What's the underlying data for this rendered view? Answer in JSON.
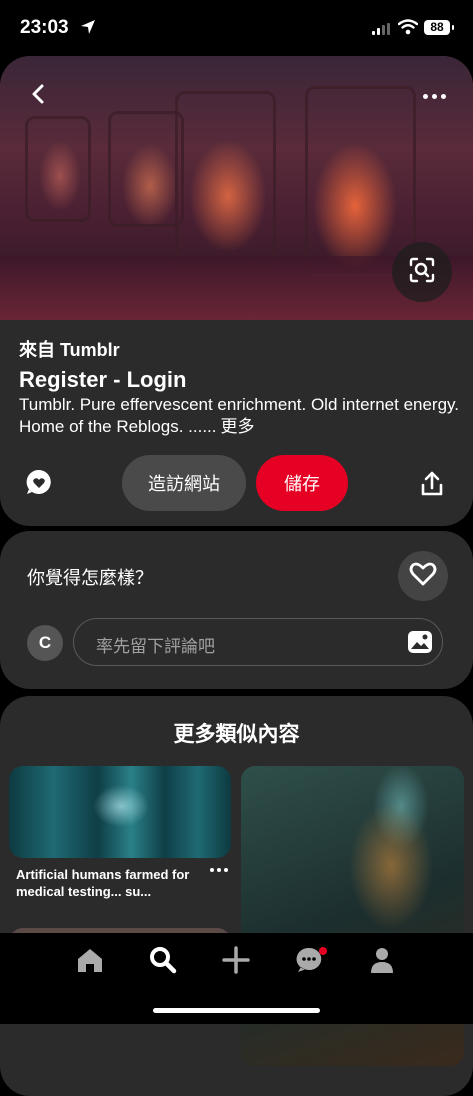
{
  "status_bar": {
    "time": "23:03",
    "battery": "88"
  },
  "pin": {
    "source_prefix": "來自",
    "source_name": "Tumblr",
    "title": "Register - Login",
    "description": "Tumblr. Pure effervescent enrichment. Old internet energy. Home of the Reblogs. ......",
    "more_label": "更多",
    "visit_label": "造訪網站",
    "save_label": "儲存",
    "save_color": "#e60023"
  },
  "comments": {
    "question": "你覺得怎麼樣？",
    "avatar_initial": "C",
    "input_placeholder": "率先留下評論吧"
  },
  "more_like_this": {
    "title": "更多類似內容",
    "items": [
      {
        "caption": "Artificial humans farmed for medical testing... su..."
      }
    ]
  },
  "icons": [
    "back-icon",
    "more-icon",
    "visual-search-icon",
    "comment-icon",
    "share-icon",
    "heart-icon",
    "image-icon",
    "home-icon",
    "search-icon",
    "plus-icon",
    "messages-icon",
    "profile-icon"
  ]
}
